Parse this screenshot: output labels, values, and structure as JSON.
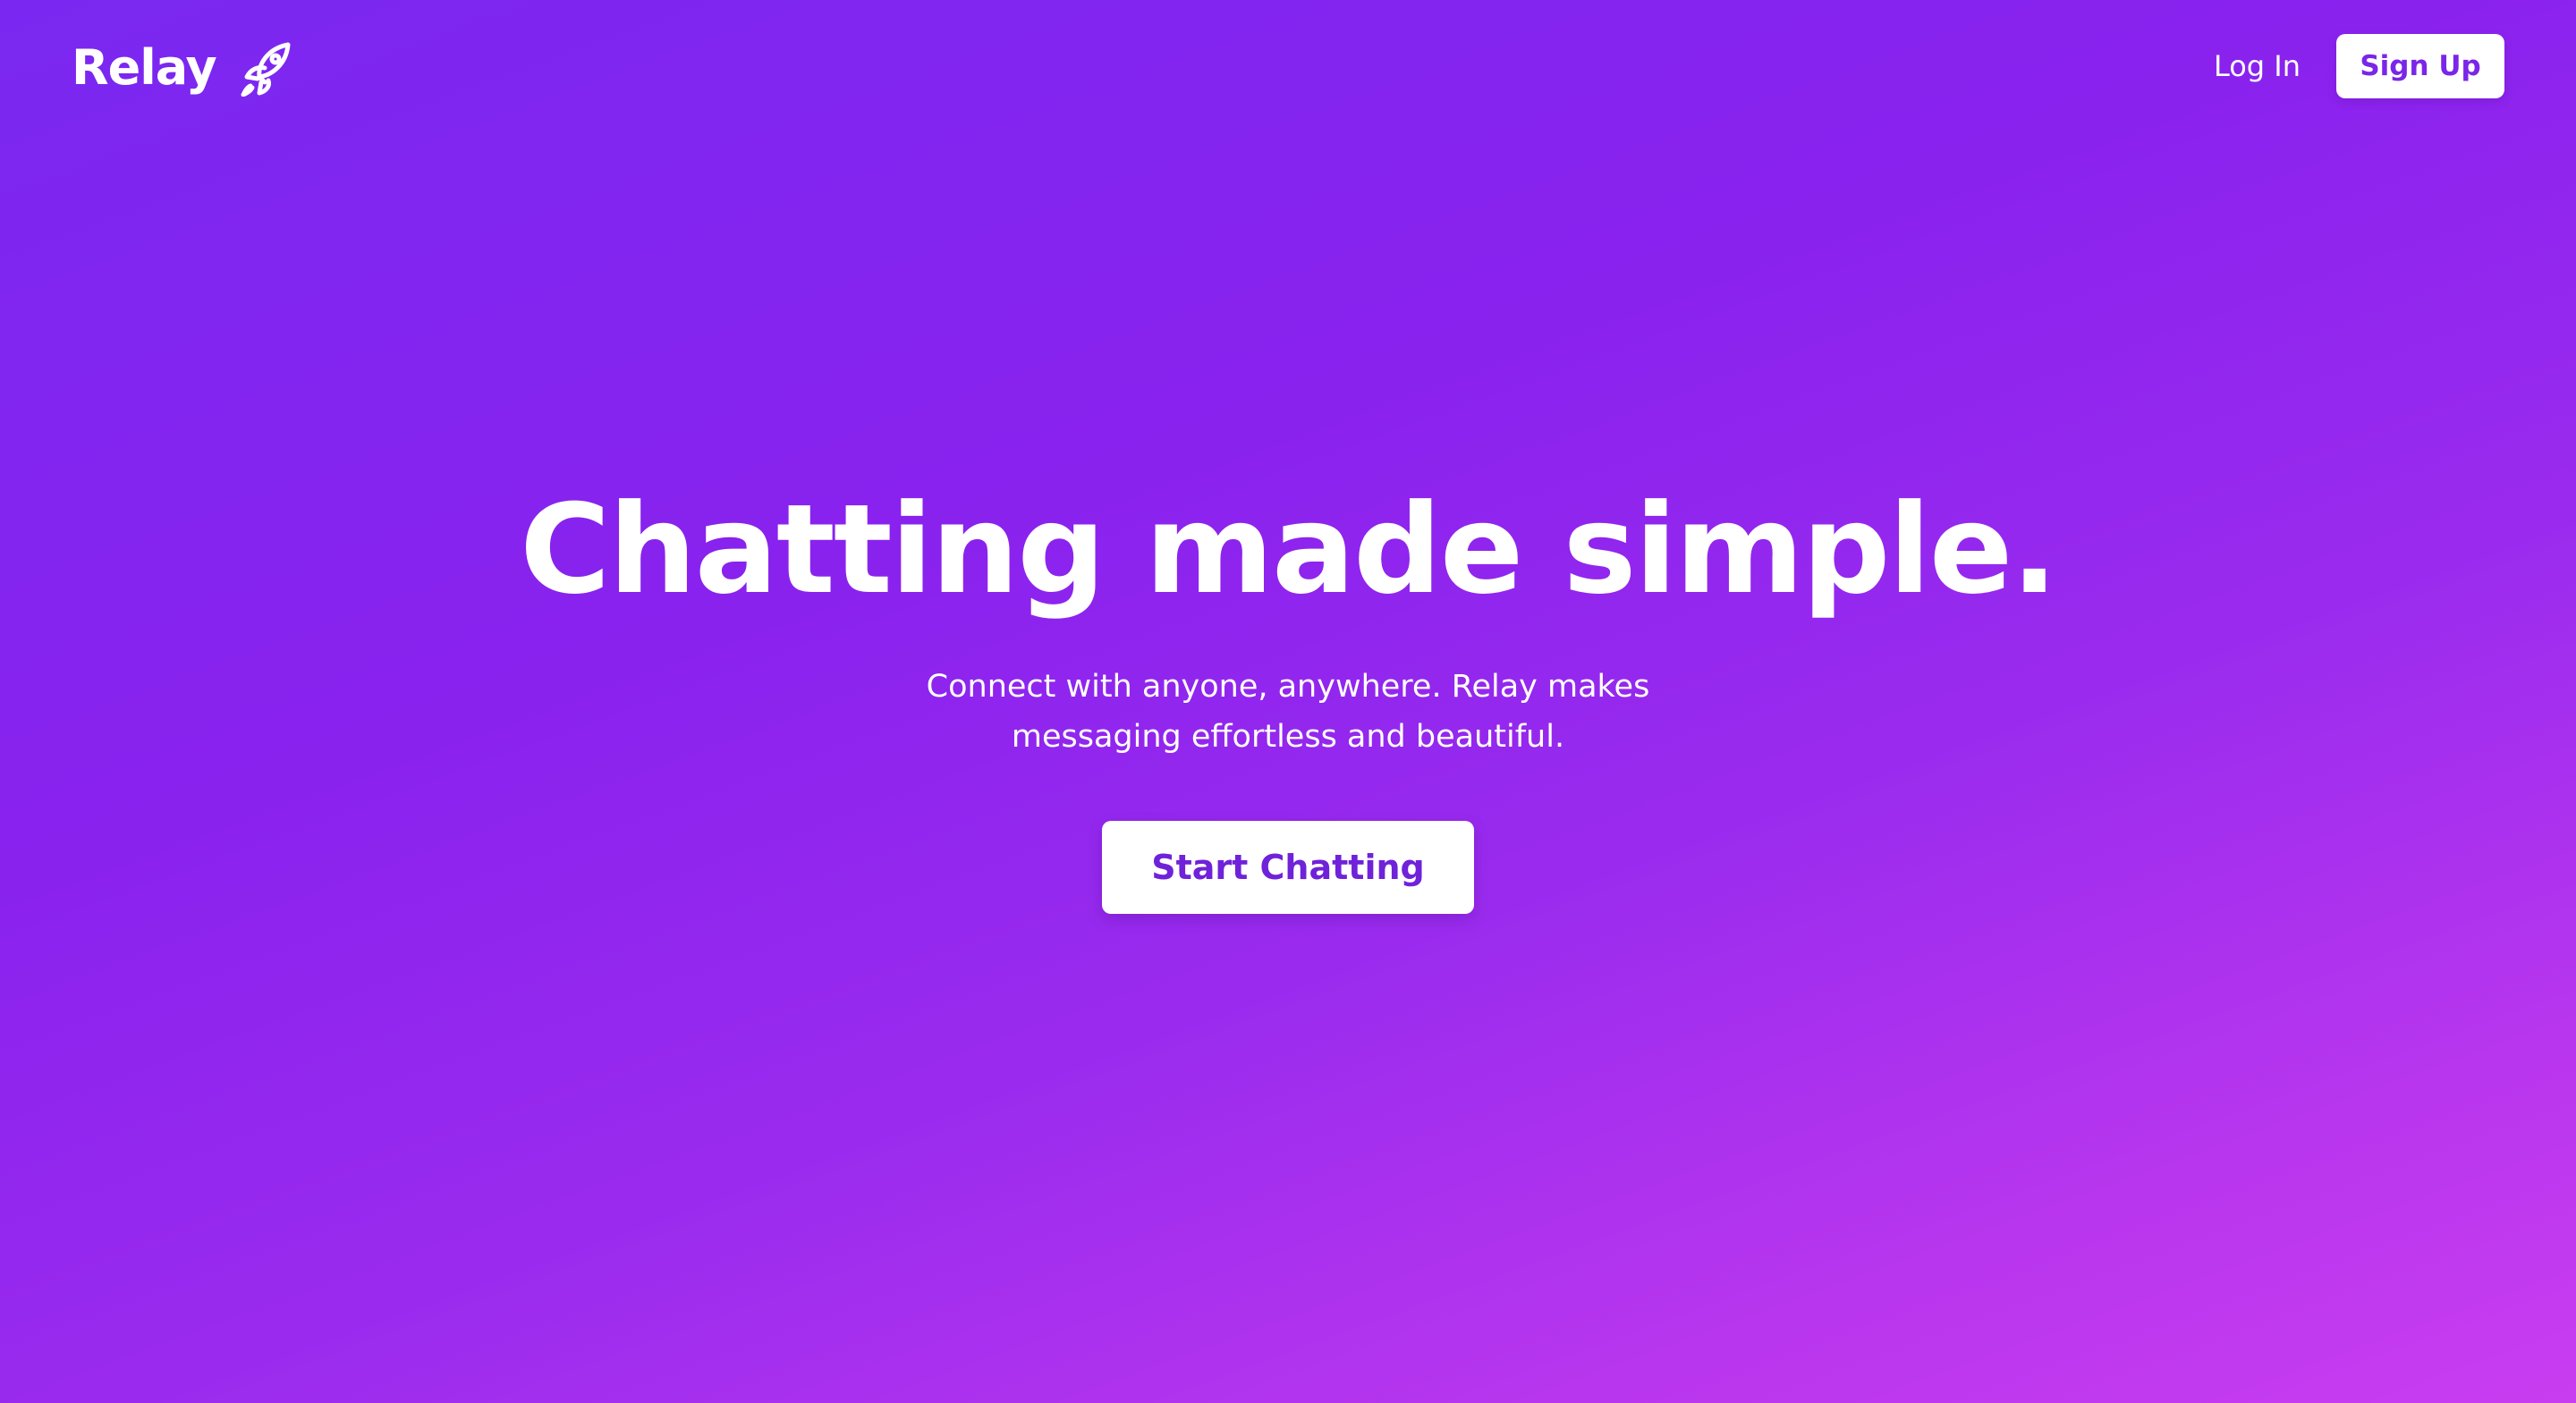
{
  "brand": {
    "name": "Relay",
    "icon": "rocket-icon"
  },
  "nav": {
    "login_label": "Log In",
    "signup_label": "Sign Up"
  },
  "hero": {
    "headline": "Chatting made simple.",
    "subheadline": "Connect with anyone, anywhere. Relay makes messaging effortless and beautiful.",
    "cta_label": "Start Chatting"
  },
  "colors": {
    "background_start": "#7a28f1",
    "background_end": "#c93df0",
    "button_background": "#ffffff",
    "button_text": "#7a26e8",
    "text": "#ffffff"
  }
}
